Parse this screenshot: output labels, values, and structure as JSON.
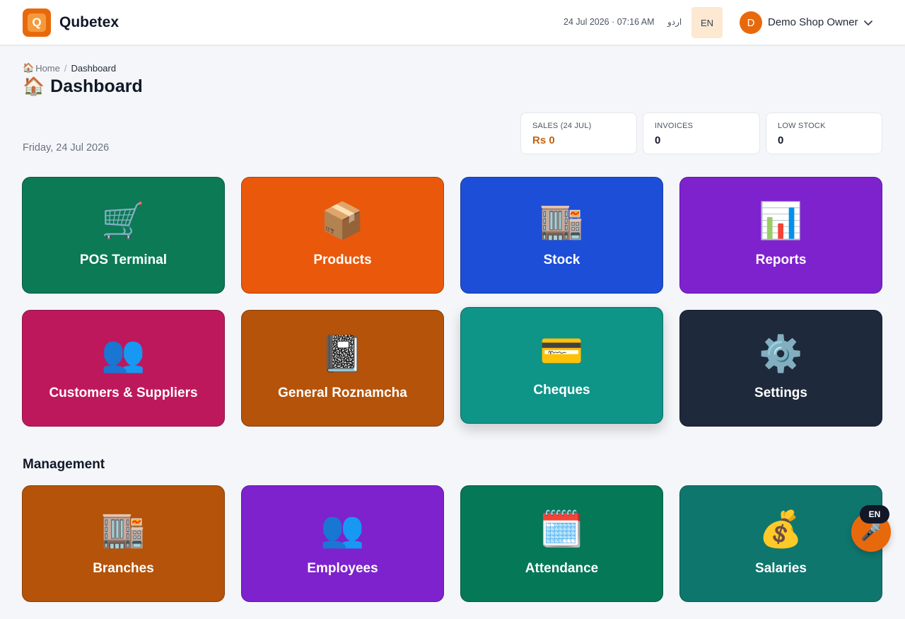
{
  "header": {
    "brand": "Qubetex",
    "logo_letter": "Q",
    "datetime": "24 Jul 2026 · 07:16 AM",
    "lang_urdu": "اردو",
    "lang_en": "EN",
    "avatar_letter": "D",
    "user_name": "Demo Shop Owner"
  },
  "breadcrumb": {
    "home_icon": "🏠",
    "home": "Home",
    "separator": "/",
    "current": "Dashboard"
  },
  "page": {
    "title_icon": "🏠",
    "title": "Dashboard",
    "date": "Friday, 24 Jul 2026"
  },
  "stats": [
    {
      "label": "SALES (24 JUL)",
      "value": "Rs 0"
    },
    {
      "label": "INVOICES",
      "value": "0"
    },
    {
      "label": "LOW STOCK",
      "value": "0"
    }
  ],
  "tiles": [
    {
      "label": "POS Terminal",
      "icon": "🛒",
      "color": "#0b7a55"
    },
    {
      "label": "Products",
      "icon": "📦",
      "color": "#ea580c"
    },
    {
      "label": "Stock",
      "icon": "🏬",
      "color": "#1d4ed8"
    },
    {
      "label": "Reports",
      "icon": "📊",
      "color": "#7e22ce"
    },
    {
      "label": "Customers & Suppliers",
      "icon": "👥",
      "color": "#be185d"
    },
    {
      "label": "General Roznamcha",
      "icon": "📓",
      "color": "#b45309"
    },
    {
      "label": "Cheques",
      "icon": "💳",
      "color": "#0f9488"
    },
    {
      "label": "Settings",
      "icon": "⚙️",
      "color": "#1e293b"
    }
  ],
  "management": {
    "title": "Management",
    "tiles": [
      {
        "label": "Branches",
        "icon": "🏬",
        "color": "#b45309"
      },
      {
        "label": "Employees",
        "icon": "👥",
        "color": "#7e22ce"
      },
      {
        "label": "Attendance",
        "icon": "🗓️",
        "color": "#047857"
      },
      {
        "label": "Salaries",
        "icon": "💰",
        "color": "#0f766e"
      }
    ]
  },
  "voice": {
    "badge": "EN",
    "icon": "🎤"
  }
}
